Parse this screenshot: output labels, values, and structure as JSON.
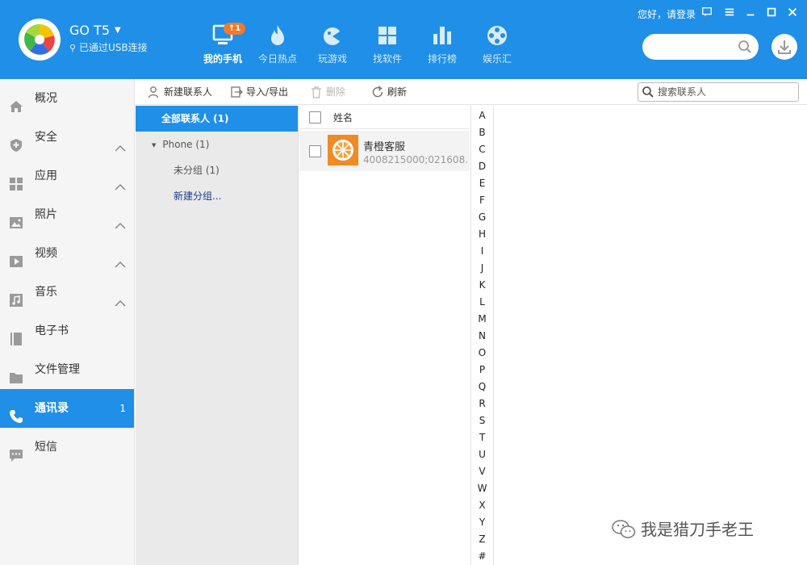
{
  "header": {
    "device_name": "GO T5",
    "device_status": "已通过USB连接",
    "login_text": "您好，请登录",
    "search_placeholder": "",
    "nav": [
      {
        "label": "我的手机",
        "badge": "↑1",
        "icon": "phone-screen-icon",
        "active": true
      },
      {
        "label": "今日热点",
        "icon": "flame-icon"
      },
      {
        "label": "玩游戏",
        "icon": "gamepad-icon"
      },
      {
        "label": "找软件",
        "icon": "apps-grid-icon"
      },
      {
        "label": "排行榜",
        "icon": "bar-chart-icon"
      },
      {
        "label": "娱乐汇",
        "icon": "film-reel-icon"
      }
    ]
  },
  "sidebar": {
    "items": [
      {
        "label": "概况",
        "icon": "home-icon"
      },
      {
        "label": "安全",
        "icon": "shield-icon",
        "expandable": true
      },
      {
        "label": "应用",
        "icon": "apps-icon",
        "expandable": true
      },
      {
        "label": "照片",
        "icon": "photo-icon",
        "expandable": true
      },
      {
        "label": "视频",
        "icon": "video-icon",
        "expandable": true
      },
      {
        "label": "音乐",
        "icon": "music-icon",
        "expandable": true
      },
      {
        "label": "电子书",
        "icon": "book-icon"
      },
      {
        "label": "文件管理",
        "icon": "folder-icon"
      },
      {
        "label": "通讯录",
        "icon": "phone-handset-icon",
        "count": "1",
        "active": true
      },
      {
        "label": "短信",
        "icon": "message-icon"
      }
    ]
  },
  "toolbar": {
    "new_contact": "新建联系人",
    "import_export": "导入/导出",
    "delete": "删除",
    "refresh": "刷新",
    "search_placeholder": "搜索联系人"
  },
  "groups": {
    "all": "全部联系人 (1)",
    "phone": "Phone (1)",
    "ungrouped": "未分组 (1)",
    "new_group": "新建分组..."
  },
  "list": {
    "name_header": "姓名",
    "contacts": [
      {
        "name": "青橙客服",
        "phone": "4008215000;021608..."
      }
    ]
  },
  "alphabet": [
    "A",
    "B",
    "C",
    "D",
    "E",
    "F",
    "G",
    "H",
    "I",
    "J",
    "K",
    "L",
    "M",
    "N",
    "O",
    "P",
    "Q",
    "R",
    "S",
    "T",
    "U",
    "V",
    "W",
    "X",
    "Y",
    "Z",
    "#"
  ],
  "watermark": "我是猎刀手老王",
  "colors": {
    "primary": "#1f8fe8",
    "badge": "#f27a2b",
    "avatar": "#f08a24",
    "sidebar_bg": "#f5f5f5",
    "group_bg": "#eaeaea"
  }
}
